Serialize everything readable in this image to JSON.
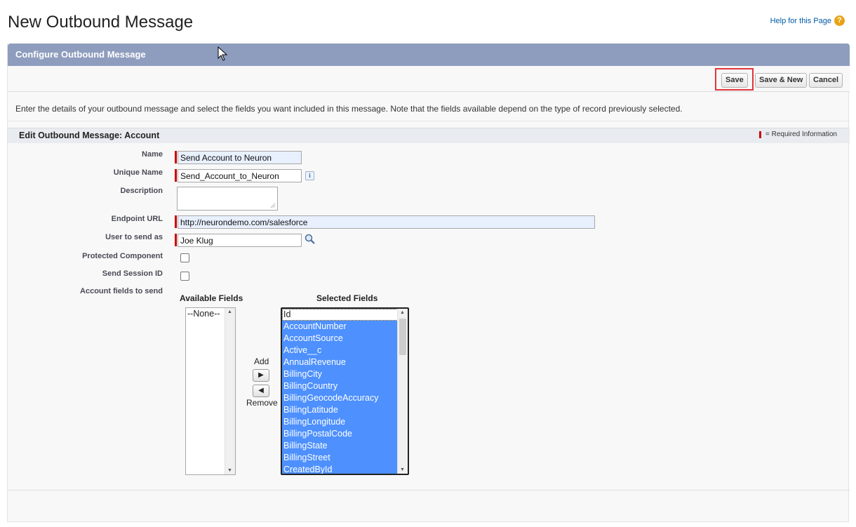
{
  "page": {
    "title": "New Outbound Message",
    "help_link": "Help for this Page",
    "help_icon": "question-circle-icon"
  },
  "panel": {
    "title": "Configure Outbound Message",
    "buttons": {
      "save": "Save",
      "save_new": "Save & New",
      "cancel": "Cancel"
    },
    "intro": "Enter the details of your outbound message and select the fields you want included in this message. Note that the fields available depend on the type of record previously selected."
  },
  "section": {
    "title": "Edit Outbound Message: Account",
    "required_legend": "= Required Information"
  },
  "form": {
    "name": {
      "label": "Name",
      "value": "Send Account to Neuron"
    },
    "unique_name": {
      "label": "Unique Name",
      "value": "Send_Account_to_Neuron",
      "info_glyph": "i"
    },
    "description": {
      "label": "Description",
      "value": ""
    },
    "endpoint_url": {
      "label": "Endpoint URL",
      "value": "http://neurondemo.com/salesforce"
    },
    "user_to_send_as": {
      "label": "User to send as",
      "value": "Joe Klug"
    },
    "protected_component": {
      "label": "Protected Component",
      "checked": false
    },
    "send_session_id": {
      "label": "Send Session ID",
      "checked": false
    },
    "account_fields": {
      "label": "Account fields to send"
    }
  },
  "fields": {
    "available_header": "Available Fields",
    "selected_header": "Selected Fields",
    "available": [
      "--None--"
    ],
    "selected": [
      "Id",
      "AccountNumber",
      "AccountSource",
      "Active__c",
      "AnnualRevenue",
      "BillingCity",
      "BillingCountry",
      "BillingGeocodeAccuracy",
      "BillingLatitude",
      "BillingLongitude",
      "BillingPostalCode",
      "BillingState",
      "BillingStreet",
      "CreatedById"
    ],
    "add_label": "Add",
    "remove_label": "Remove"
  },
  "colors": {
    "header_bar": "#8e9dbe",
    "required": "#cc0000",
    "selection": "#4d90fe",
    "highlight": "#e0353b"
  }
}
